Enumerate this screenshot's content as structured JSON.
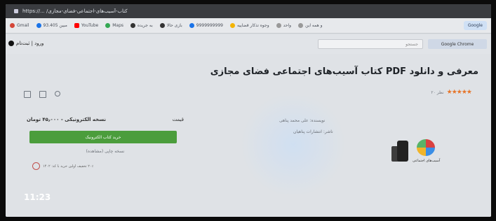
{
  "browser": {
    "url": "https://... /کتاب-آسیب‌های-اجتماعی-فضای-مجازی",
    "bookmarks": [
      {
        "label": "Gmail",
        "color": "#d44638"
      },
      {
        "label": "مبین 93.405",
        "color": "#1a73e8"
      },
      {
        "label": "YouTube",
        "color": "#ff0000"
      },
      {
        "label": "Maps",
        "color": "#34a853"
      },
      {
        "label": "به جریده",
        "color": "#333333"
      },
      {
        "label": "بازی حالا",
        "color": "#333333"
      },
      {
        "label": "9999999999",
        "color": "#1a73e8"
      },
      {
        "label": "وجوه تذکار قضاییه",
        "color": "#f4b400"
      },
      {
        "label": "واحد",
        "color": "#999999"
      },
      {
        "label": "و همه این",
        "color": "#999999"
      }
    ],
    "bookmarks_right": "Google"
  },
  "header": {
    "login": "ورود | ثبت‌نام",
    "search_placeholder": "جستجو",
    "category_button": "Google Chrome"
  },
  "product": {
    "title": "معرفی و دانلود PDF کتاب آسیب‌های اجتماعی فضای مجازی",
    "stars": "★★★★★",
    "rating_text": "۲۰ نظر",
    "author": "نویسنده: علی محمد پناهی",
    "publisher": "ناشر: انتشارات پناهیان",
    "cover_text": "آسیب‌های اجتماعی"
  },
  "buybox": {
    "price_label": "قیمت",
    "price": "نسخه الکترونیکی - ۴۵٫۰۰۰ تومان",
    "buy_button": "خرید کتاب الکترونیک",
    "plan_text": "نسخه چاپی (مشاهده)",
    "discount_text": "۲۰٪ تخفیف اولین خرید با کد: ۱۴۰۲"
  },
  "status": {
    "clock": "11:23"
  }
}
